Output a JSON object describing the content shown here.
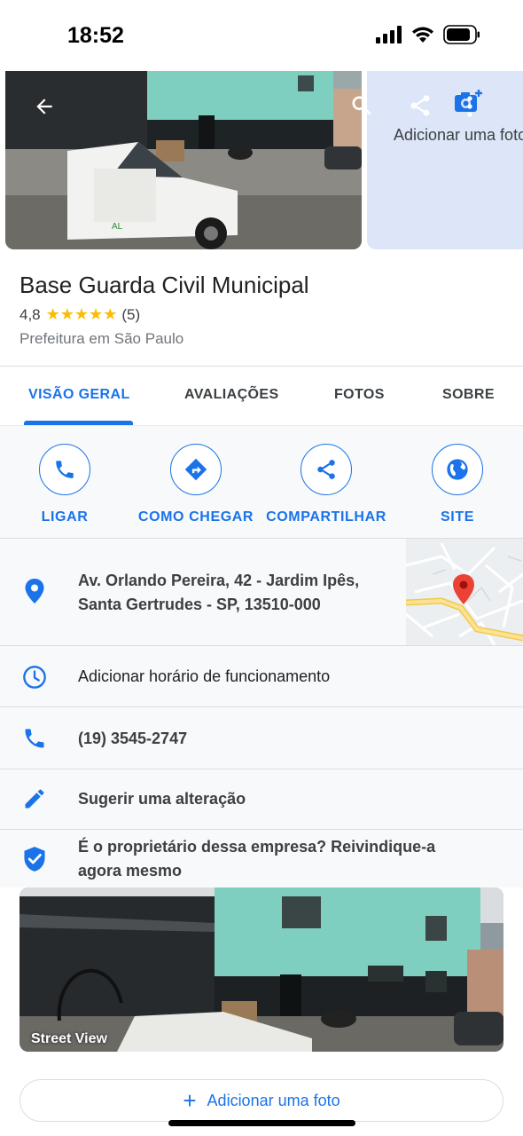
{
  "status_bar": {
    "time": "18:52"
  },
  "header": {
    "add_photo_label": "Adicionar uma foto"
  },
  "place": {
    "name": "Base Guarda Civil Municipal",
    "rating": "4,8",
    "stars": "★★★★★",
    "review_count": "(5)",
    "category": "Prefeitura em São Paulo"
  },
  "tabs": [
    {
      "label": "VISÃO GERAL",
      "active": true
    },
    {
      "label": "AVALIAÇÕES"
    },
    {
      "label": "FOTOS"
    },
    {
      "label": "SOBRE"
    }
  ],
  "actions": [
    {
      "label": "LIGAR",
      "icon": "phone-icon"
    },
    {
      "label": "COMO CHEGAR",
      "icon": "directions-icon"
    },
    {
      "label": "COMPARTILHAR",
      "icon": "share-icon"
    },
    {
      "label": "SITE",
      "icon": "globe-icon"
    }
  ],
  "info": {
    "address_line1": "Av. Orlando Pereira, 42 - Jardim Ipês,",
    "address_line2": "Santa Gertrudes - SP, 13510-000",
    "hours": "Adicionar horário de funcionamento",
    "phone": "(19) 3545-2747",
    "suggest_edit": "Sugerir uma alteração",
    "claim_line1": "É o proprietário dessa empresa? Reivindique-a",
    "claim_line2": "agora mesmo"
  },
  "street_view": {
    "label": "Street View"
  },
  "footer": {
    "add_photo_button": "Adicionar uma foto",
    "plus": "+"
  },
  "colors": {
    "accent": "#1a73e8",
    "star": "#fbbc04",
    "pin": "#ea4335",
    "building": "#7fcfc0"
  }
}
